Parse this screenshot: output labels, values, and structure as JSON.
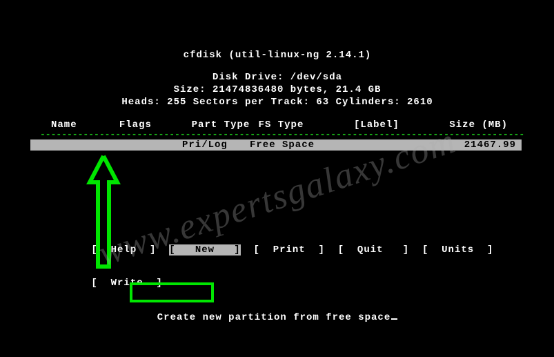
{
  "title": "cfdisk (util-linux-ng 2.14.1)",
  "drive_line": "Disk Drive: /dev/sda",
  "size_line": "Size: 21474836480 bytes, 21.4 GB",
  "geom_line": "Heads: 255   Sectors per Track: 63   Cylinders: 2610",
  "columns": {
    "name": "Name",
    "flags": "Flags",
    "part_type": "Part Type",
    "fs_type": "FS Type",
    "label": "[Label]",
    "size_mb": "Size (MB)"
  },
  "separator": "------------------------------------------------------------------------------------------------------------",
  "row": {
    "name": "",
    "flags": "",
    "part_type": "Pri/Log",
    "fs_type": "Free Space",
    "label": "",
    "size_mb": "21467.99"
  },
  "menu": {
    "line1": {
      "help": "[  Help  ]",
      "new": "[   New   ]",
      "print": "[  Print  ]",
      "quit": "[  Quit   ]",
      "units": "[  Units  ]"
    },
    "line2": {
      "write": "[  Write  ]"
    }
  },
  "hint": "Create new partition from free space",
  "watermark": "www.expertsgalaxy.com"
}
